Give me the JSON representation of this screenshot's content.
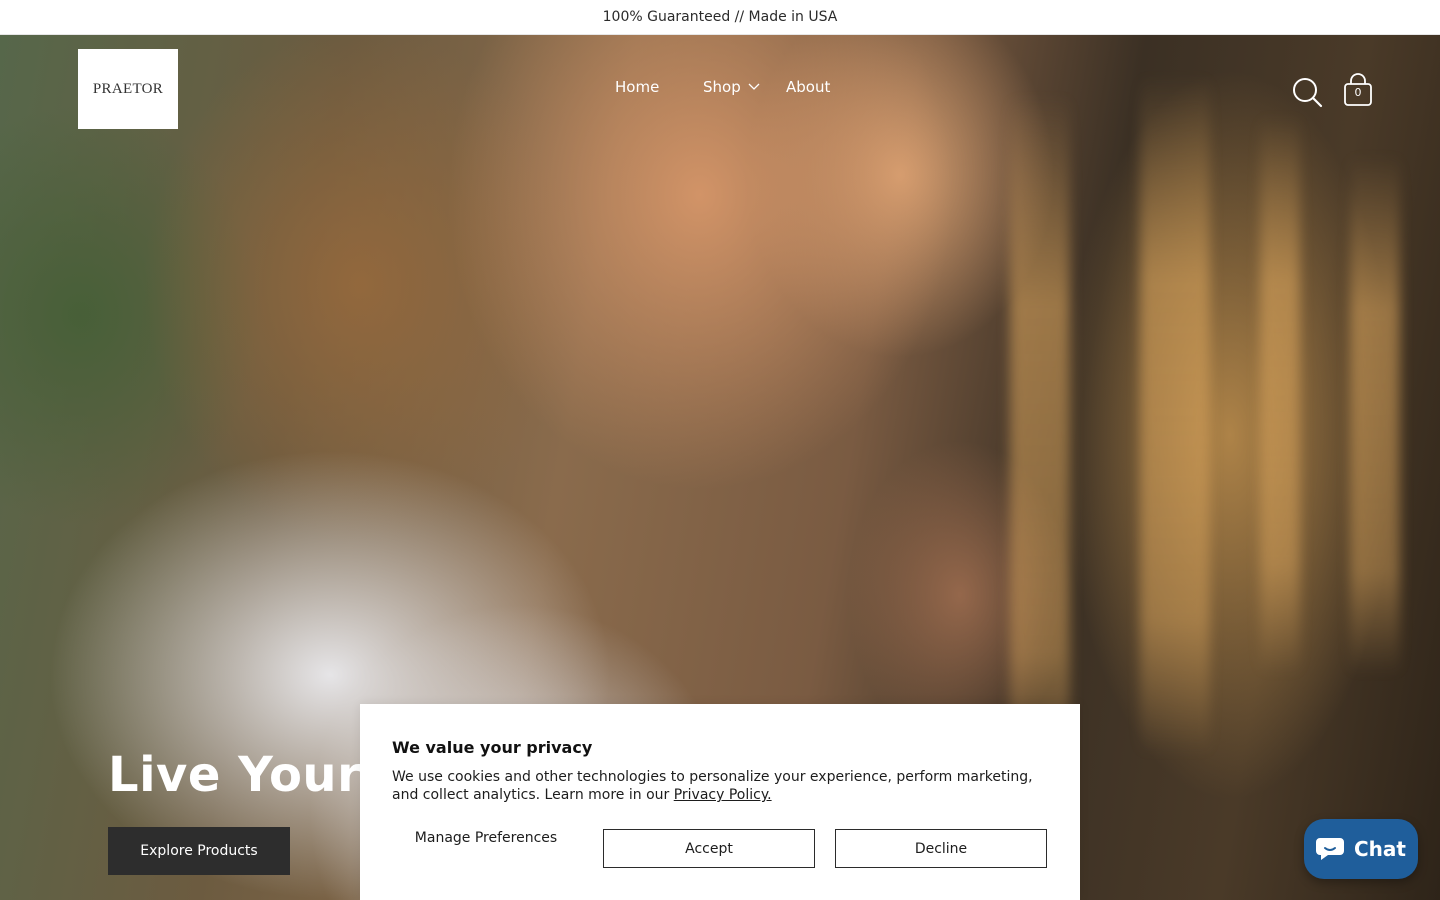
{
  "announcement": {
    "text": "100% Guaranteed // Made in USA"
  },
  "header": {
    "logo_text": "PRAETOR",
    "nav": [
      {
        "label": "Home"
      },
      {
        "label": "Shop",
        "has_dropdown": true
      },
      {
        "label": "About"
      }
    ],
    "cart_count": "0",
    "icons": [
      "search-icon",
      "bag-icon",
      "chevron-down-icon"
    ]
  },
  "hero": {
    "title": "Live Your B",
    "cta_label": "Explore Products"
  },
  "privacy": {
    "title": "We value your privacy",
    "body": "We use cookies and other technologies to personalize your experience, perform marketing, and collect analytics. Learn more in our ",
    "link_text": "Privacy Policy.",
    "manage_label": "Manage Preferences",
    "accept_label": "Accept",
    "decline_label": "Decline"
  },
  "chat": {
    "label": "Chat",
    "brand_color": "#1f5e9b"
  }
}
